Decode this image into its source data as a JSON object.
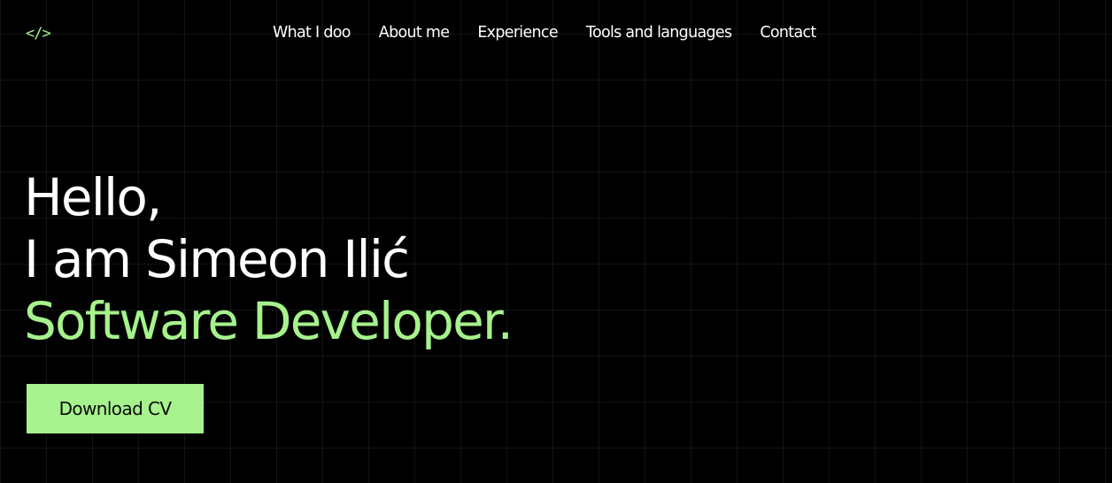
{
  "colors": {
    "background": "#000000",
    "accent": "#a6f28c",
    "text": "#ffffff"
  },
  "header": {
    "logo_text": "</>",
    "nav": [
      {
        "label": "What I doo"
      },
      {
        "label": "About me"
      },
      {
        "label": "Experience"
      },
      {
        "label": "Tools and languages"
      },
      {
        "label": "Contact"
      }
    ]
  },
  "hero": {
    "greeting": "Hello,",
    "name_line": "I am Simeon Ilić",
    "role": "Software Developer.",
    "cta_label": "Download CV"
  }
}
